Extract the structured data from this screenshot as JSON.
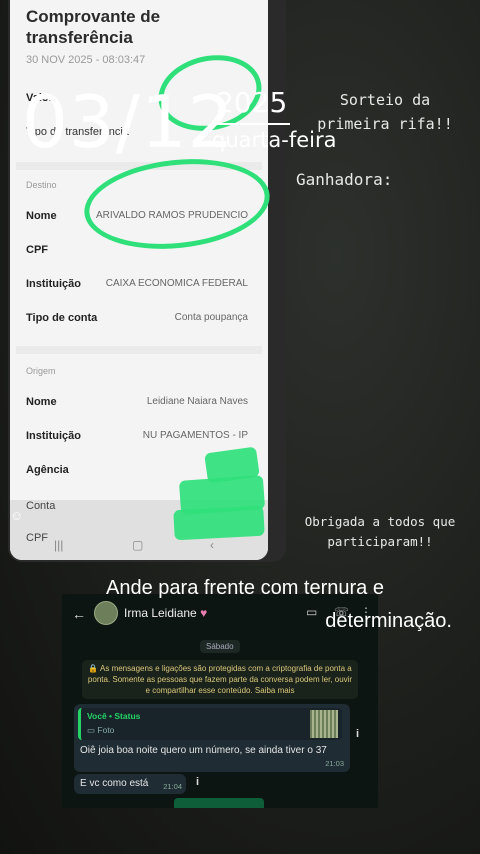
{
  "receipt": {
    "title": "Comprovante de transferência",
    "date": "30 NOV 2025 - 08:03:47",
    "valor_label": "Valor",
    "tipo_transferencia_label": "Tipo de transferência",
    "destino": {
      "section_label": "Destino",
      "rows": [
        {
          "label": "Nome",
          "value": "ARIVALDO RAMOS PRUDENCIO"
        },
        {
          "label": "CPF",
          "value": ""
        },
        {
          "label": "Instituição",
          "value": "CAIXA ECONOMICA FEDERAL"
        },
        {
          "label": "Tipo de conta",
          "value": "Conta poupança"
        }
      ]
    },
    "origem": {
      "section_label": "Origem",
      "rows": [
        {
          "label": "Nome",
          "value": "Leidiane Naiara Naves"
        },
        {
          "label": "Instituição",
          "value": "NU PAGAMENTOS - IP"
        },
        {
          "label": "Agência",
          "value": ""
        },
        {
          "label": "Conta",
          "value": ""
        },
        {
          "label": "CPF",
          "value": ""
        }
      ]
    },
    "nav_icons": [
      "menu-icon",
      "home-icon",
      "back-icon"
    ]
  },
  "story": {
    "date": "03/12",
    "year": "2025",
    "weekday": "quarta-feira",
    "sorteio_line1": "Sorteio da",
    "sorteio_line2": "primeira rifa!!",
    "ganhadora": "Ganhadora:",
    "obrigada_line1": "Obrigada a todos que",
    "obrigada_line2": "participaram!!",
    "motto_line1": "Ande para frente com ternura e",
    "motto_line2": "determinação.",
    "highlight_color": "#2fe07a"
  },
  "chat": {
    "contact_name": "Irma Leidiane",
    "day": "Sábado",
    "encryption_notice": "🔒 As mensagens e ligações são protegidas com a criptografia de ponta a ponta. Somente as pessoas que fazem parte da conversa podem ler, ouvir e compartilhar esse conteúdo. Saiba mais",
    "reply_author": "Você • Status",
    "reply_type": "Foto",
    "message1": "Oiê joia boa noite quero um número, se ainda tiver o 37",
    "message1_time": "21:03",
    "message2": "E vc como está",
    "message2_time": "21:04",
    "accent": "#25d366"
  }
}
